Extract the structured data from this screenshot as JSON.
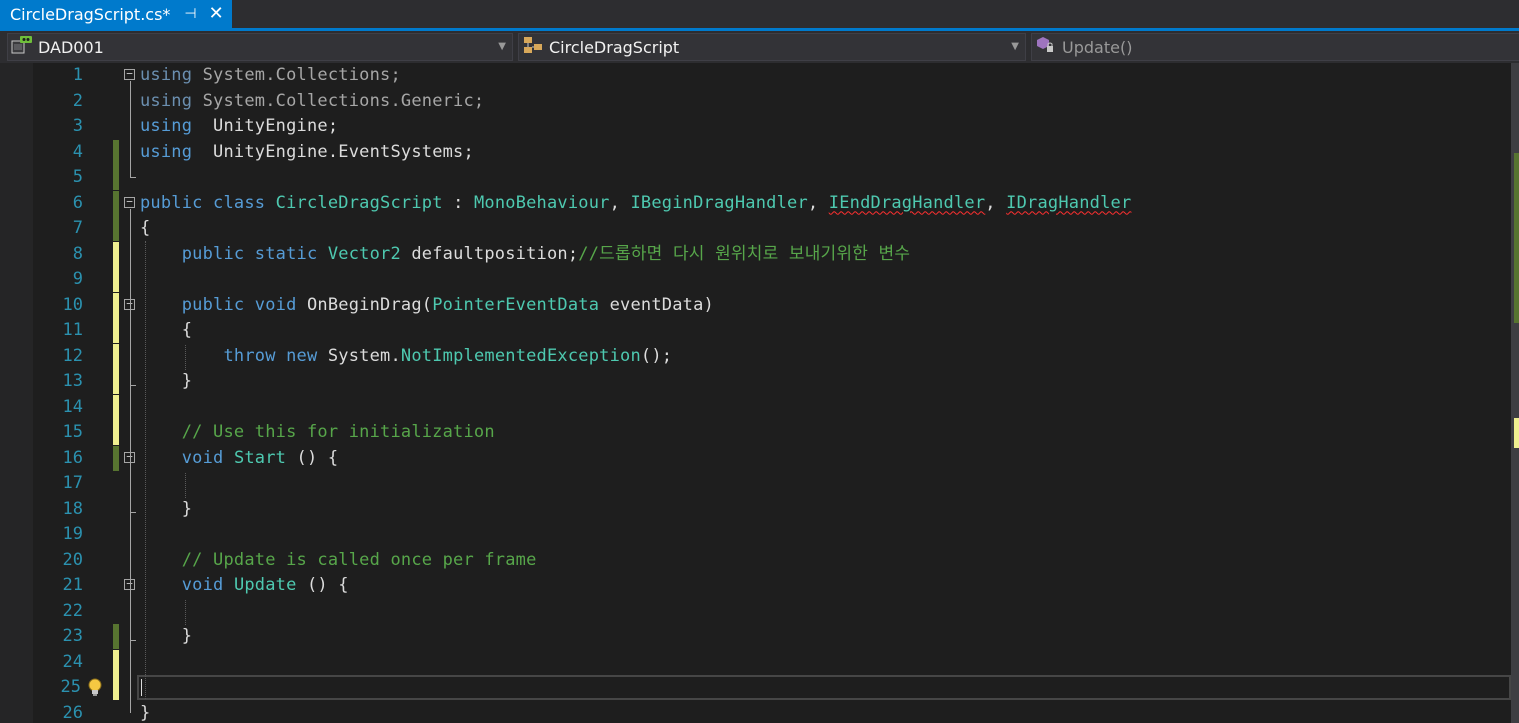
{
  "tab": {
    "title": "CircleDragScript.cs*",
    "pin_glyph": "⊣",
    "close_glyph": "✕"
  },
  "nav": {
    "project": "DAD001",
    "class": "CircleDragScript",
    "member": "Update()"
  },
  "lines": [
    {
      "n": "1",
      "tokens": [
        [
          "kwdim",
          "using"
        ],
        [
          "dim",
          " System.Collections;"
        ]
      ]
    },
    {
      "n": "2",
      "tokens": [
        [
          "kwdim",
          "using"
        ],
        [
          "dim",
          " System.Collections.Generic;"
        ]
      ]
    },
    {
      "n": "3",
      "tokens": [
        [
          "kw",
          "using"
        ],
        [
          "",
          "  UnityEngine;"
        ]
      ]
    },
    {
      "n": "4",
      "tokens": [
        [
          "kw",
          "using"
        ],
        [
          "",
          "  UnityEngine.EventSystems;"
        ]
      ]
    },
    {
      "n": "5",
      "tokens": []
    },
    {
      "n": "6",
      "tokens": [
        [
          "kw",
          "public"
        ],
        [
          "",
          " "
        ],
        [
          "kw",
          "class"
        ],
        [
          "",
          " "
        ],
        [
          "type",
          "CircleDragScript"
        ],
        [
          "",
          " : "
        ],
        [
          "type",
          "MonoBehaviour"
        ],
        [
          "",
          ", "
        ],
        [
          "type",
          "IBeginDragHandler"
        ],
        [
          "",
          ", "
        ],
        [
          "type err",
          "IEndDragHandler"
        ],
        [
          "",
          ", "
        ],
        [
          "type err",
          "IDragHandler"
        ]
      ]
    },
    {
      "n": "7",
      "tokens": [
        [
          "",
          "{"
        ]
      ]
    },
    {
      "n": "8",
      "tokens": [
        [
          "",
          "    "
        ],
        [
          "kw",
          "public"
        ],
        [
          "",
          " "
        ],
        [
          "kw",
          "static"
        ],
        [
          "",
          " "
        ],
        [
          "type",
          "Vector2"
        ],
        [
          "",
          " defaultposition;"
        ],
        [
          "cm",
          "//드롭하면 다시 원위치로 보내기위한 변수"
        ]
      ]
    },
    {
      "n": "9",
      "tokens": []
    },
    {
      "n": "10",
      "tokens": [
        [
          "",
          "    "
        ],
        [
          "kw",
          "public"
        ],
        [
          "",
          " "
        ],
        [
          "kw",
          "void"
        ],
        [
          "",
          " OnBeginDrag("
        ],
        [
          "type",
          "PointerEventData"
        ],
        [
          "",
          " eventData)"
        ]
      ]
    },
    {
      "n": "11",
      "tokens": [
        [
          "",
          "    {"
        ]
      ]
    },
    {
      "n": "12",
      "tokens": [
        [
          "",
          "        "
        ],
        [
          "kw",
          "throw"
        ],
        [
          "",
          " "
        ],
        [
          "kw",
          "new"
        ],
        [
          "",
          " System."
        ],
        [
          "type",
          "NotImplementedException"
        ],
        [
          "",
          "();"
        ]
      ]
    },
    {
      "n": "13",
      "tokens": [
        [
          "",
          "    }"
        ]
      ]
    },
    {
      "n": "14",
      "tokens": []
    },
    {
      "n": "15",
      "tokens": [
        [
          "",
          "    "
        ],
        [
          "cm",
          "// Use this for initialization"
        ]
      ]
    },
    {
      "n": "16",
      "tokens": [
        [
          "",
          "    "
        ],
        [
          "kw",
          "void"
        ],
        [
          "",
          " "
        ],
        [
          "type",
          "Start"
        ],
        [
          "",
          " () {"
        ]
      ]
    },
    {
      "n": "17",
      "tokens": []
    },
    {
      "n": "18",
      "tokens": [
        [
          "",
          "    }"
        ]
      ]
    },
    {
      "n": "19",
      "tokens": []
    },
    {
      "n": "20",
      "tokens": [
        [
          "",
          "    "
        ],
        [
          "cm",
          "// Update is called once per frame"
        ]
      ]
    },
    {
      "n": "21",
      "tokens": [
        [
          "",
          "    "
        ],
        [
          "kw",
          "void"
        ],
        [
          "",
          " "
        ],
        [
          "type",
          "Update"
        ],
        [
          "",
          " () {"
        ]
      ]
    },
    {
      "n": "22",
      "tokens": []
    },
    {
      "n": "23",
      "tokens": [
        [
          "",
          "    }"
        ]
      ]
    },
    {
      "n": "24",
      "tokens": []
    },
    {
      "n": "25",
      "tokens": []
    },
    {
      "n": "26",
      "tokens": [
        [
          "",
          "}"
        ]
      ]
    }
  ],
  "colors": {
    "accent": "#007acc",
    "keyword": "#569cd6",
    "type": "#4ec9b0",
    "comment": "#57a64a",
    "line_number": "#2b91af",
    "saved_change": "#577430",
    "unsaved_change": "#efef90"
  },
  "icons": {
    "project": "csharp-project-icon",
    "class": "class-icon",
    "member": "method-icon",
    "bulb": "lightbulb-icon"
  }
}
